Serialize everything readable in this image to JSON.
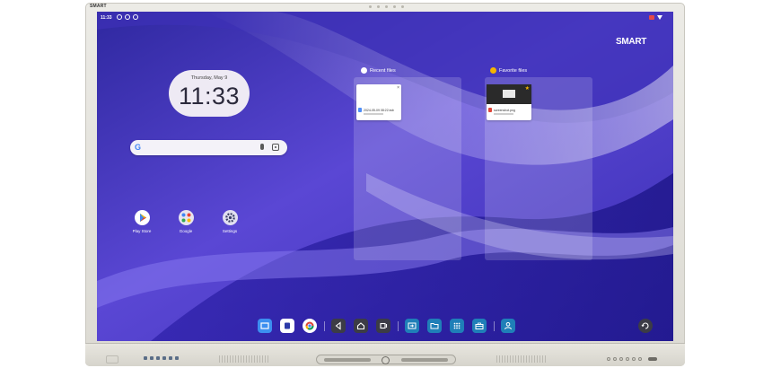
{
  "device": {
    "brand_mark": "SMART"
  },
  "status_bar": {
    "time": "11:33"
  },
  "screen": {
    "logo_text": "SMART",
    "wallpaper_colors": [
      "#3a2fa8",
      "#6a58e0",
      "#8d7cf0",
      "#c8c2f4"
    ]
  },
  "clock_widget": {
    "date": "Thursday, May 9",
    "time": "11:33"
  },
  "search_bar": {
    "logo": "G",
    "mic_icon": "microphone-icon",
    "lens_icon": "google-lens-icon"
  },
  "apps": [
    {
      "label": "Play Store",
      "icon": "play-store-icon"
    },
    {
      "label": "Google",
      "icon": "google-folder-icon"
    },
    {
      "label": "Settings",
      "icon": "settings-gear-icon"
    }
  ],
  "recent_files": {
    "title": "Recent files",
    "items": [
      {
        "name": "2024-05-09 08:22.iwb",
        "close": "×"
      }
    ]
  },
  "favorite_files": {
    "title": "Favorite files",
    "items": [
      {
        "name": "screenshot.png",
        "star": "★"
      }
    ]
  },
  "taskbar": {
    "accent": "#2b8ac9",
    "buttons": [
      "whiteboard-icon",
      "notebook-icon",
      "chrome-icon",
      "back-icon",
      "home-icon",
      "recent-apps-icon",
      "input-source-icon",
      "files-icon",
      "apps-grid-icon",
      "toolbox-icon",
      "user-signin-icon",
      "screen-rotate-icon"
    ]
  }
}
